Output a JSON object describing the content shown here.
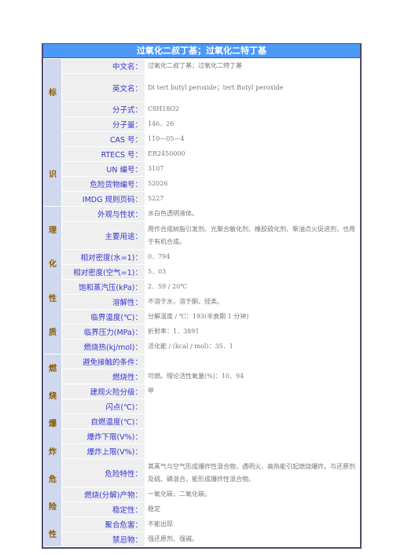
{
  "title": "过氧化二叔丁基；过氧化二特丁基",
  "colors": {
    "title_bg": "#4d99f7",
    "section_bg": "#d0d8ee",
    "label_bg": "#efefef",
    "label_text": "#3434d0",
    "section_text": "#8a5a00",
    "value_text": "#777777"
  },
  "sections": [
    {
      "name": "标识",
      "chars": [
        "标",
        "",
        "识"
      ],
      "rows": [
        {
          "label": "中文名：",
          "value": "过氧化二叔丁基；过氧化二特丁基"
        },
        {
          "label": "英文名：",
          "value": "Di tert butyl peroxide；tert Butyl peroxide"
        },
        {
          "label": "分子式：",
          "value": "C8H18O2"
        },
        {
          "label": "分子量：",
          "value": "146．26"
        },
        {
          "label": "CAS 号：",
          "value": "110—05—4"
        },
        {
          "label": "RTECS 号：",
          "value": "ER2450000"
        },
        {
          "label": "UN 编号：",
          "value": "3107"
        },
        {
          "label": "危险货物编号：",
          "value": "52026"
        },
        {
          "label": "IMDG 规则页码：",
          "value": "5227"
        }
      ]
    },
    {
      "name": "理化性质",
      "chars": [
        "理",
        "化",
        "性",
        "质"
      ],
      "rows": [
        {
          "label": "外观与性状：",
          "value": "水白色透明液体。"
        },
        {
          "label": "主要用途：",
          "value": "用作合成树脂引发剂、光聚合敏化剂、橡胶硫化剂、柴油点火促进剂，也用于有机合成。"
        },
        {
          "label": "相对密度(水=1)：",
          "value": "0．794"
        },
        {
          "label": "相对密度(空气=1)：",
          "value": "5．03"
        },
        {
          "label": "饱和蒸汽压(kPa)：",
          "value": "2．59 / 20℃"
        },
        {
          "label": "溶解性：",
          "value": "不溶于水，溶于酮、烃类。"
        },
        {
          "label": "临界温度(℃)：",
          "value": "分解温度 / ℃：193(半衰期 1 分钟)"
        },
        {
          "label": "临界压力(MPa)：",
          "value": "折射率：1．3891"
        },
        {
          "label": "燃烧热(kj/mol)：",
          "value": "活化能 / (kcal / mol)：35．1"
        }
      ]
    },
    {
      "name": "燃烧爆炸危险性",
      "chars": [
        "燃",
        "烧",
        "爆",
        "炸",
        "危",
        "险",
        "性"
      ],
      "rows": [
        {
          "label": "避免接触的条件：",
          "value": ""
        },
        {
          "label": "燃烧性：",
          "value": "可燃。理论活性氧量(%)：10．94"
        },
        {
          "label": "建规火险分级：",
          "value": "甲"
        },
        {
          "label": "闪点(℃)：",
          "value": ""
        },
        {
          "label": "自燃温度(℃)：",
          "value": ""
        },
        {
          "label": "爆炸下限(V%)：",
          "value": ""
        },
        {
          "label": "爆炸上限(V%)：",
          "value": ""
        },
        {
          "label": "危险特性：",
          "value": "其蒸气与空气形成爆炸性混合物，遇明火、高热能引起燃烧爆炸。与还原剂及硫、磷混合，能形成爆炸性混合物。"
        },
        {
          "label": "燃烧(分解)产物：",
          "value": "一氧化碳、二氧化碳。"
        },
        {
          "label": "稳定性：",
          "value": "稳定"
        },
        {
          "label": "聚合危害：",
          "value": "不能出现"
        },
        {
          "label": "禁忌物：",
          "value": "强还原剂、强碱。"
        }
      ]
    }
  ]
}
